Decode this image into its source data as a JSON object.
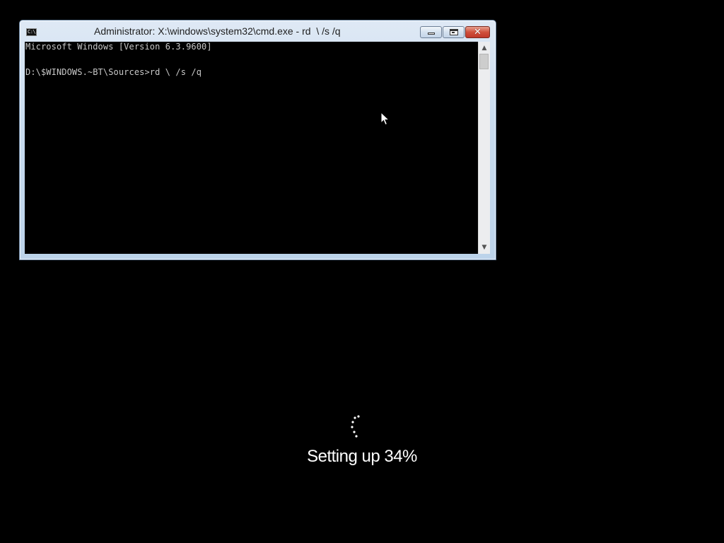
{
  "window": {
    "title": "Administrator: X:\\windows\\system32\\cmd.exe - rd  \\ /s /q",
    "icon_label": "C:\\."
  },
  "console": {
    "lines": [
      "Microsoft Windows [Version 6.3.9600]",
      "D:\\$WINDOWS.~BT\\Sources>rd \\ /s /q"
    ]
  },
  "setup": {
    "label": "Setting up 34%",
    "progress_percent": 34
  },
  "colors": {
    "desktop_background": "#000000",
    "console_text": "#c8c8c8",
    "setup_text": "#ffffff",
    "close_button": "#c0382a"
  },
  "icons": {
    "window_icon": "cmd-icon",
    "minimize": "minimize-icon",
    "maximize": "maximize-icon",
    "close": "close-icon",
    "scroll_up": "chevron-up-icon",
    "scroll_down": "chevron-down-icon",
    "cursor": "mouse-pointer-icon",
    "spinner": "loading-spinner-icon"
  }
}
